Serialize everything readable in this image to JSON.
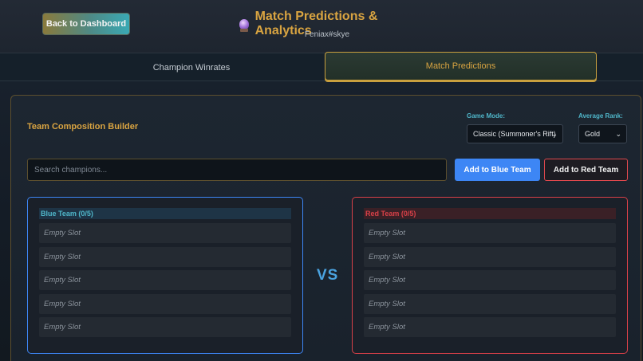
{
  "header": {
    "back_label": "Back to Dashboard",
    "title": "Match Predictions & Analytics",
    "title_icon": "crystal-ball-icon",
    "subtitle": "Feniax#skye"
  },
  "tabs": [
    {
      "label": "Champion Winrates",
      "active": false
    },
    {
      "label": "Match Predictions",
      "active": true
    }
  ],
  "builder": {
    "title": "Team Composition Builder",
    "game_mode": {
      "label": "Game Mode:",
      "selected": "Classic (Summoner's Rift)"
    },
    "avg_rank": {
      "label": "Average Rank:",
      "selected": "Gold"
    },
    "search_placeholder": "Search champions...",
    "add_blue_label": "Add to Blue Team",
    "add_red_label": "Add to Red Team"
  },
  "blue_team": {
    "title": "Blue Team (0/5)",
    "slots": [
      "Empty Slot",
      "Empty Slot",
      "Empty Slot",
      "Empty Slot",
      "Empty Slot"
    ]
  },
  "red_team": {
    "title": "Red Team (0/5)",
    "slots": [
      "Empty Slot",
      "Empty Slot",
      "Empty Slot",
      "Empty Slot",
      "Empty Slot"
    ]
  },
  "vs_label": "VS",
  "colors": {
    "accent_gold": "#d9a441",
    "label_cyan": "#4fb6c9",
    "blue_team": "#3d86f5",
    "red_team": "#d84048"
  }
}
